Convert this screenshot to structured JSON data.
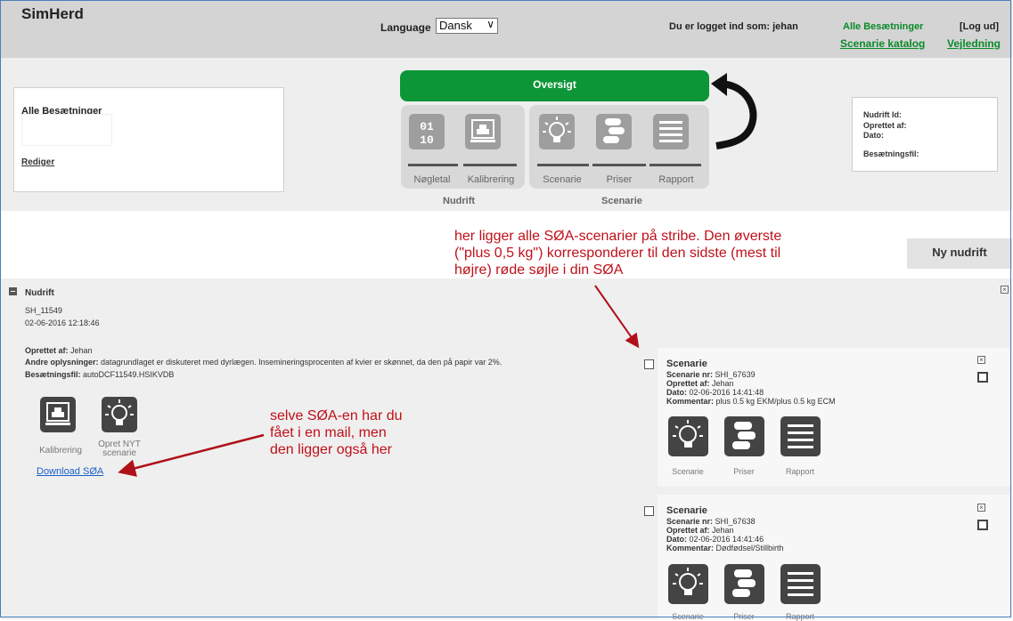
{
  "header": {
    "logo": "SimHerd",
    "language_label": "Language",
    "language_value": "Dansk",
    "login_text": "Du er logget ind som: jehan",
    "all_herds_link": "Alle Besætninger",
    "logout_link": "[Log ud]",
    "catalog_link": "Scenarie katalog",
    "guide_link": "Vejledning"
  },
  "herd_box": {
    "title": "Alle Besætninger",
    "edit_link": "Rediger"
  },
  "workflow": {
    "overview_button": "Oversigt",
    "nudrift_tiles": [
      {
        "label": "Nøgletal",
        "icon": "numbers-icon"
      },
      {
        "label": "Kalibrering",
        "icon": "calibration-icon"
      }
    ],
    "scenarie_tiles": [
      {
        "label": "Scenarie",
        "icon": "lightbulb-icon"
      },
      {
        "label": "Priser",
        "icon": "coins-icon"
      },
      {
        "label": "Rapport",
        "icon": "report-icon"
      }
    ],
    "nudrift_caption": "Nudrift",
    "scenarie_caption": "Scenarie"
  },
  "info_box": {
    "nudrift_id": "Nudrift Id:",
    "created_by": "Oprettet af:",
    "date": "Dato:",
    "herd_file": "Besætningsfil:"
  },
  "ny_nudrift_button": "Ny nudrift",
  "nudrift_section": {
    "title": "Nudrift",
    "id": "SH_11549",
    "datetime": "02-06-2016 12:18:46",
    "created_by_label": "Oprettet af:",
    "created_by_value": "Jehan",
    "other_info_label": "Andre oplysninger:",
    "other_info_value": "datagrundlaget er diskuteret med dyrlægen. Insemineringsprocenten af kvier er skønnet, da den på papir var 2%.",
    "herd_file_label": "Besætningsfil:",
    "herd_file_value": "autoDCF11549.HSIKVDB",
    "actions": [
      {
        "label": "Kalibrering",
        "icon": "calibration-icon"
      },
      {
        "label": "Opret NYT scenarie",
        "icon": "lightbulb-icon"
      }
    ],
    "download_link": "Download SØA"
  },
  "scenarios": [
    {
      "title": "Scenarie",
      "nr_label": "Scenarie nr:",
      "nr_value": "SHI_67639",
      "created_label": "Oprettet af:",
      "created_value": "Jehan",
      "date_label": "Dato:",
      "date_value": "02-06-2016 14:41:48",
      "comment_label": "Kommentar:",
      "comment_value": "plus 0.5 kg EKM/plus 0.5 kg ECM",
      "buttons": [
        "Scenarie",
        "Priser",
        "Rapport"
      ]
    },
    {
      "title": "Scenarie",
      "nr_label": "Scenarie nr:",
      "nr_value": "SHI_67638",
      "created_label": "Oprettet af:",
      "created_value": "Jehan",
      "date_label": "Dato:",
      "date_value": "02-06-2016 14:41:46",
      "comment_label": "Kommentar:",
      "comment_value": "Dødfødsel/Stillbirth",
      "buttons": [
        "Scenarie",
        "Priser",
        "Rapport"
      ]
    }
  ],
  "annotations": {
    "top_lines": [
      "her ligger alle SØA-scenarier på stribe. Den øverste",
      "(\"plus 0,5 kg\")  korresponderer til den sidste (mest til",
      "højre) røde søjle i din SØA"
    ],
    "mid_lines": [
      "selve SØA-en har du",
      "fået i en mail, men",
      "den ligger også her"
    ]
  },
  "colors": {
    "green": "#0d9638",
    "annotation_red": "#c0101a",
    "link_blue": "#1a5fc8"
  }
}
